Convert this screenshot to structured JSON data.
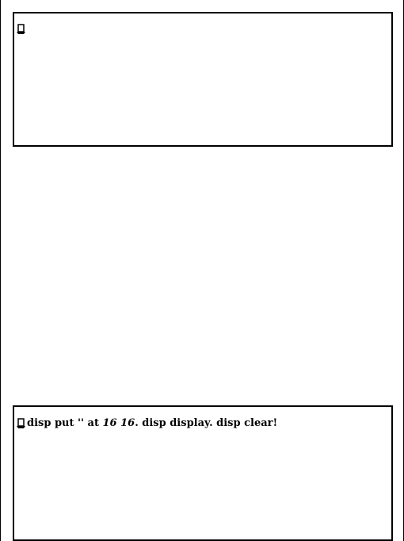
{
  "top_pane": {
    "text": ""
  },
  "bottom_pane": {
    "parts": [
      "disp put '' at ",
      "16 16",
      ". disp display. disp clear",
      "!"
    ]
  },
  "icons": {
    "cursor": "caret-hat-icon"
  }
}
